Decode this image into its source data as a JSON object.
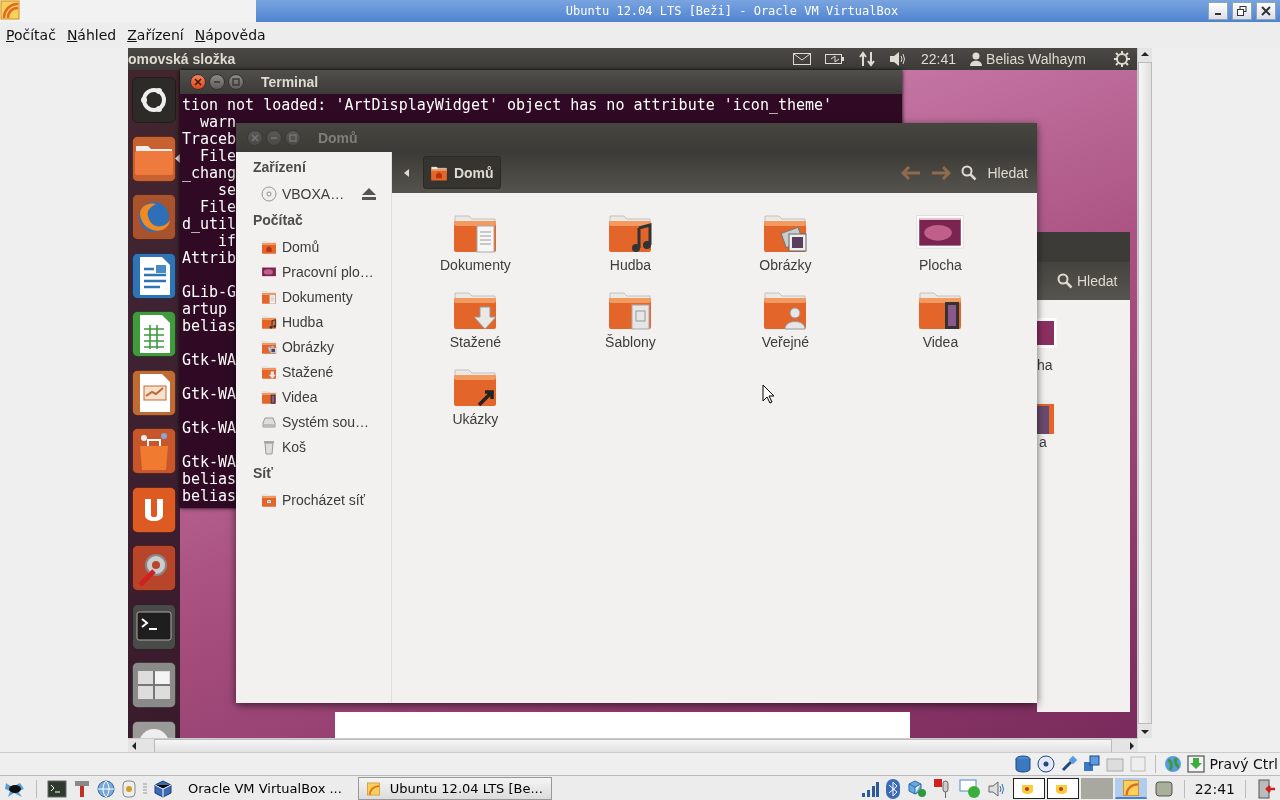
{
  "host_window": {
    "title": "Ubuntu 12.04 LTS [Beži] - Oracle VM VirtualBox"
  },
  "menu": [
    "Počítač",
    "Náhled",
    "Zařízení",
    "Nápověda"
  ],
  "guest": {
    "top_panel": {
      "app_title": "omovská složka",
      "clock": "22:41",
      "user": "Belias Walhaym"
    },
    "launcher": [
      {
        "kind": "dash",
        "running": false
      },
      {
        "kind": "files",
        "running": true
      },
      {
        "kind": "browser",
        "running": false
      },
      {
        "kind": "writer",
        "running": false
      },
      {
        "kind": "calc",
        "running": false
      },
      {
        "kind": "impress",
        "running": false
      },
      {
        "kind": "store",
        "running": false
      },
      {
        "kind": "cloud",
        "running": false
      },
      {
        "kind": "settings",
        "running": false
      },
      {
        "kind": "terminal",
        "running": false
      },
      {
        "kind": "workspaces",
        "running": false
      },
      {
        "kind": "disc"
      }
    ],
    "terminal": {
      "title": "Terminal",
      "blocks": [
        [
          "tion not loaded: 'ArtDisplayWidget' object has no attribute 'icon_theme'",
          "  warn",
          "Traceb",
          "  File",
          "_chang",
          "    se",
          "  File",
          "d_util",
          "    if",
          "Attrib"
        ],
        [
          "GLib-G",
          "artup",
          "belias"
        ],
        [
          "Gtk-WA"
        ],
        [
          "Gtk-WA"
        ],
        [
          "Gtk-WA"
        ],
        [
          "Gtk-WA",
          "belias",
          "belias"
        ]
      ]
    },
    "files_window": {
      "title": "Domů",
      "sidebar": [
        {
          "heading": "Zařízení",
          "items": [
            {
              "label": "VBOXA…",
              "kind": "disc",
              "eject": true
            }
          ]
        },
        {
          "heading": "Počítač",
          "items": [
            {
              "label": "Domů",
              "kind": "home",
              "eject": false
            },
            {
              "label": "Pracovní plo…",
              "kind": "desktop",
              "eject": false
            },
            {
              "label": "Dokumenty",
              "kind": "documents",
              "eject": false
            },
            {
              "label": "Hudba",
              "kind": "music",
              "eject": false
            },
            {
              "label": "Obrázky",
              "kind": "pictures",
              "eject": false
            },
            {
              "label": "Stažené",
              "kind": "downloads",
              "eject": false
            },
            {
              "label": "Videa",
              "kind": "videos",
              "eject": false
            },
            {
              "label": "Systém sou…",
              "kind": "drive",
              "eject": false
            },
            {
              "label": "Koš",
              "kind": "trash",
              "eject": false
            }
          ]
        },
        {
          "heading": "Síť",
          "items": [
            {
              "label": "Procházet síť",
              "kind": "network",
              "eject": false
            }
          ]
        }
      ],
      "path_button": "Domů",
      "search": "Hledat",
      "items": [
        {
          "label": "Dokumenty",
          "kind": "documents"
        },
        {
          "label": "Hudba",
          "kind": "music"
        },
        {
          "label": "Obrázky",
          "kind": "pictures"
        },
        {
          "label": "Plocha",
          "kind": "desktop"
        },
        {
          "label": "Stažené",
          "kind": "downloads"
        },
        {
          "label": "Šablony",
          "kind": "templates"
        },
        {
          "label": "Veřejné",
          "kind": "public"
        },
        {
          "label": "Videa",
          "kind": "videos"
        },
        {
          "label": "Ukázky",
          "kind": "examples"
        }
      ]
    },
    "back_window": {
      "search": "Hledat",
      "labels": [
        "ha",
        "a"
      ]
    }
  },
  "status_bar": {
    "host_key": "Pravý Ctrl"
  },
  "taskbar": {
    "tasks": [
      {
        "label": "Oracle VM VirtualBox ...",
        "selected": false
      },
      {
        "label": "Ubuntu 12.04 LTS [Be...",
        "selected": true
      }
    ],
    "clock": "22:41"
  }
}
